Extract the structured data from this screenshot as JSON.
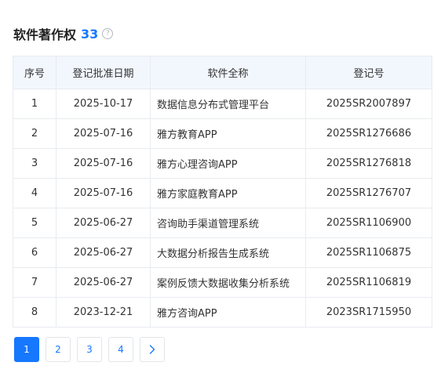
{
  "section": {
    "title": "软件著作权",
    "count": "33",
    "help_icon": "help-circle-icon",
    "help_glyph": "?"
  },
  "table": {
    "headers": [
      "序号",
      "登记批准日期",
      "软件全称",
      "登记号"
    ],
    "rows": [
      [
        "1",
        "2025-10-17",
        "数据信息分布式管理平台",
        "2025SR2007897"
      ],
      [
        "2",
        "2025-07-16",
        "雅方教育APP",
        "2025SR1276686"
      ],
      [
        "3",
        "2025-07-16",
        "雅方心理咨询APP",
        "2025SR1276818"
      ],
      [
        "4",
        "2025-07-16",
        "雅方家庭教育APP",
        "2025SR1276707"
      ],
      [
        "5",
        "2025-06-27",
        "咨询助手渠道管理系统",
        "2025SR1106900"
      ],
      [
        "6",
        "2025-06-27",
        "大数据分析报告生成系统",
        "2025SR1106875"
      ],
      [
        "7",
        "2025-06-27",
        "案例反馈大数据收集分析系统",
        "2025SR1106819"
      ],
      [
        "8",
        "2023-12-21",
        "雅方咨询APP",
        "2023SR1715950"
      ]
    ]
  },
  "pagination": {
    "pages": [
      "1",
      "2",
      "3",
      "4"
    ],
    "current": "1",
    "next_icon": "chevron-right-icon",
    "accent": "#1677ff"
  }
}
